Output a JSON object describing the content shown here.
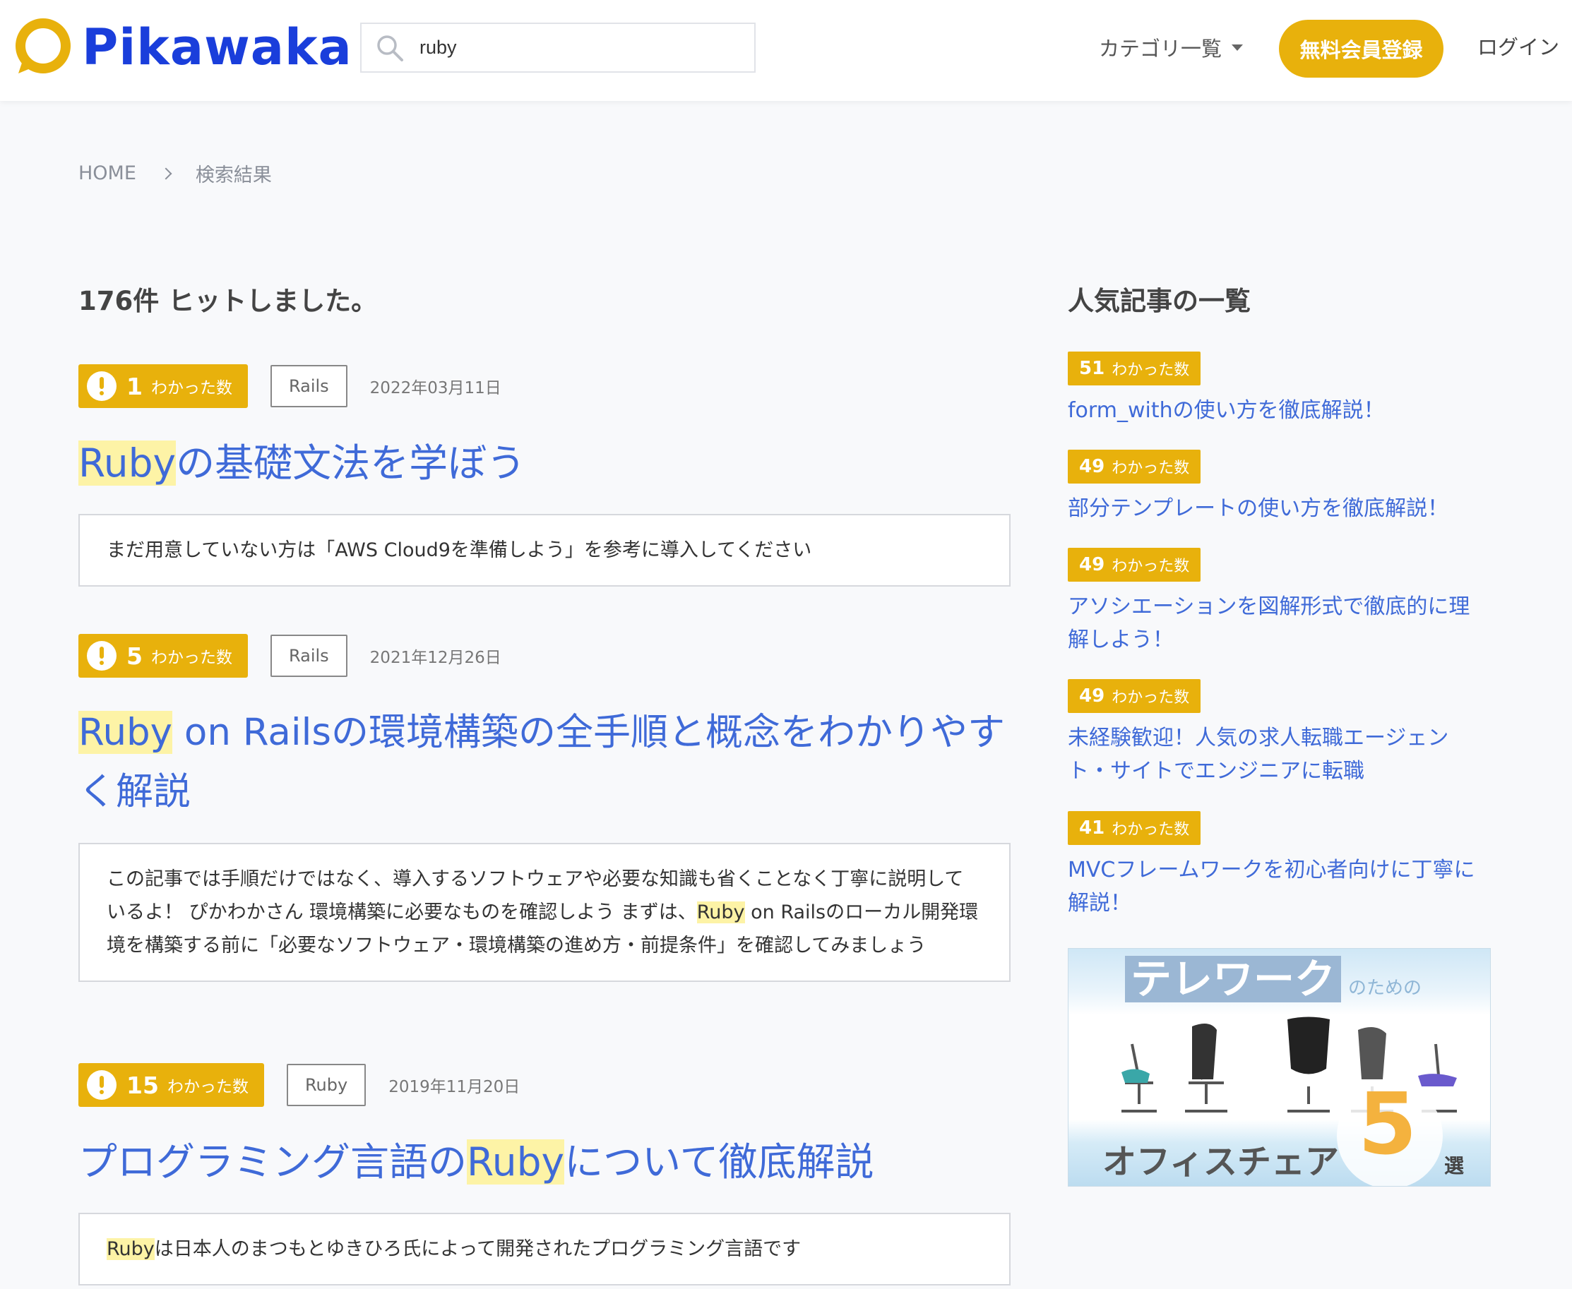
{
  "header": {
    "logo_text": "Pikawaka",
    "search": {
      "value": "ruby"
    },
    "category_label": "カテゴリ一覧",
    "signup_label": "無料会員登録",
    "login_label": "ログイン"
  },
  "breadcrumb": {
    "home": "HOME",
    "current": "検索結果"
  },
  "result_count": "176件 ヒットしました。",
  "wakatta_label": "わかった数",
  "articles": [
    {
      "count": "1",
      "tag": "Rails",
      "date": "2022年03月11日",
      "title_hl": "Ruby",
      "title_rest": "の基礎文法を学ぼう",
      "excerpt": "まだ用意していない方は「AWS Cloud9を準備しよう」を参考に導入してください"
    },
    {
      "count": "5",
      "tag": "Rails",
      "date": "2021年12月26日",
      "title_hl": "Ruby",
      "title_rest": " on Railsの環境構築の全手順と概念をわかりやすく解説",
      "excerpt_pre": "この記事では手順だけではなく、導入するソフトウェアや必要な知識も省くことなく丁寧に説明しているよ！ ぴかわかさん 環境構築に必要なものを確認しよう まずは、",
      "excerpt_hl": "Ruby",
      "excerpt_post": " on Railsのローカル開発環境を構築する前に「必要なソフトウェア・環境構築の進め方・前提条件」を確認してみましょう"
    },
    {
      "count": "15",
      "tag": "Ruby",
      "date": "2019年11月20日",
      "title_pre": "プログラミング言語の",
      "title_hl": "Ruby",
      "title_rest": "について徹底解説",
      "excerpt_hl": "Ruby",
      "excerpt_post": "は日本人のまつもとゆきひろ氏によって開発されたプログラミング言語です"
    }
  ],
  "sidebar": {
    "title": "人気記事の一覧",
    "items": [
      {
        "count": "51",
        "title": "form_withの使い方を徹底解説！"
      },
      {
        "count": "49",
        "title": "部分テンプレートの使い方を徹底解説！"
      },
      {
        "count": "49",
        "title": "アソシエーションを図解形式で徹底的に理解しよう！"
      },
      {
        "count": "49",
        "title": "未経験歓迎！人気の求人転職エージェント・サイトでエンジニアに転職"
      },
      {
        "count": "41",
        "title": "MVCフレームワークを初心者向けに丁寧に解説！"
      }
    ]
  },
  "ad": {
    "top": "テレワーク",
    "top_small": "のための",
    "bottom": "オフィスチェア",
    "number": "5",
    "suffix": "選"
  },
  "colors": {
    "brand": "#1a3edb",
    "accent": "#e8b10c",
    "link": "#3f6ad8",
    "highlight": "#fdf3a6"
  },
  "icons": [
    "speech-bubble-logo-icon",
    "search-icon",
    "caret-down-icon",
    "exclamation-icon",
    "chevron-right-icon"
  ]
}
